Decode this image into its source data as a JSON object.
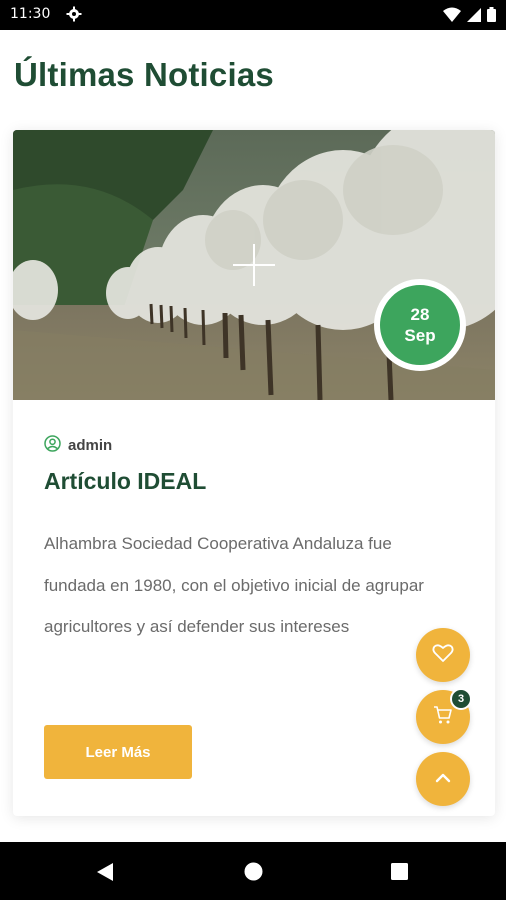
{
  "status_bar": {
    "time": "11:30"
  },
  "page": {
    "title": "Últimas Noticias"
  },
  "article": {
    "date_day": "28",
    "date_month": "Sep",
    "author": "admin",
    "title": "Artículo IDEAL",
    "excerpt": "Alhambra Sociedad Cooperativa Andaluza fue fundada en 1980, con el objetivo inicial de agrupar agricultores y así defender sus intereses",
    "read_more_label": "Leer Más"
  },
  "fabs": {
    "cart_count": "3"
  },
  "colors": {
    "brand_green": "#1f4d34",
    "accent_yellow": "#f0b43c",
    "badge_green": "#3da55d"
  },
  "icons": [
    "settings-icon",
    "wifi-icon",
    "signal-icon",
    "battery-icon",
    "user-icon",
    "heart-icon",
    "cart-icon",
    "chevron-up-icon",
    "back-icon",
    "home-icon",
    "recents-icon"
  ]
}
